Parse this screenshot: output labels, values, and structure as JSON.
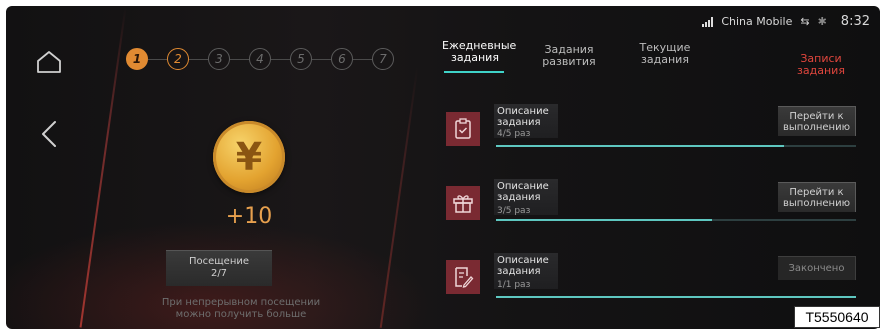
{
  "status": {
    "carrier": "China Mobile",
    "time": "8:32"
  },
  "steps": [
    "1",
    "2",
    "3",
    "4",
    "5",
    "6",
    "7"
  ],
  "checkin": {
    "coin_symbol": "¥",
    "reward": "+10",
    "visit_label": "Посещение",
    "visit_count": "2/7",
    "hint_line1": "При непрерывном посещении",
    "hint_line2": "можно получить больше"
  },
  "tabs": {
    "daily_l1": "Ежедневные",
    "daily_l2": "задания",
    "growth_l1": "Задания",
    "growth_l2": "развития",
    "current_l1": "Текущие",
    "current_l2": "задания",
    "records_l1": "Записи",
    "records_l2": "задания"
  },
  "tasks": [
    {
      "icon": "clipboard-check-icon",
      "desc_l1": "Описание",
      "desc_l2": "задания",
      "count": "4/5 раз",
      "progress": 0.8,
      "action_l1": "Перейти к",
      "action_l2": "выполнению"
    },
    {
      "icon": "gift-icon",
      "desc_l1": "Описание",
      "desc_l2": "задания",
      "count": "3/5 раз",
      "progress": 0.6,
      "action_l1": "Перейти к",
      "action_l2": "выполнению"
    },
    {
      "icon": "document-edit-icon",
      "desc_l1": "Описание",
      "desc_l2": "задания",
      "count": "1/1 раз",
      "progress": 1.0,
      "action_l1": "Закончено",
      "action_l2": ""
    }
  ],
  "image_code": "T5550640",
  "colors": {
    "accent_orange": "#e08a32",
    "accent_teal": "#3fd3c8",
    "records_red": "#e0463d",
    "task_icon_bg": "#7a2a32"
  }
}
